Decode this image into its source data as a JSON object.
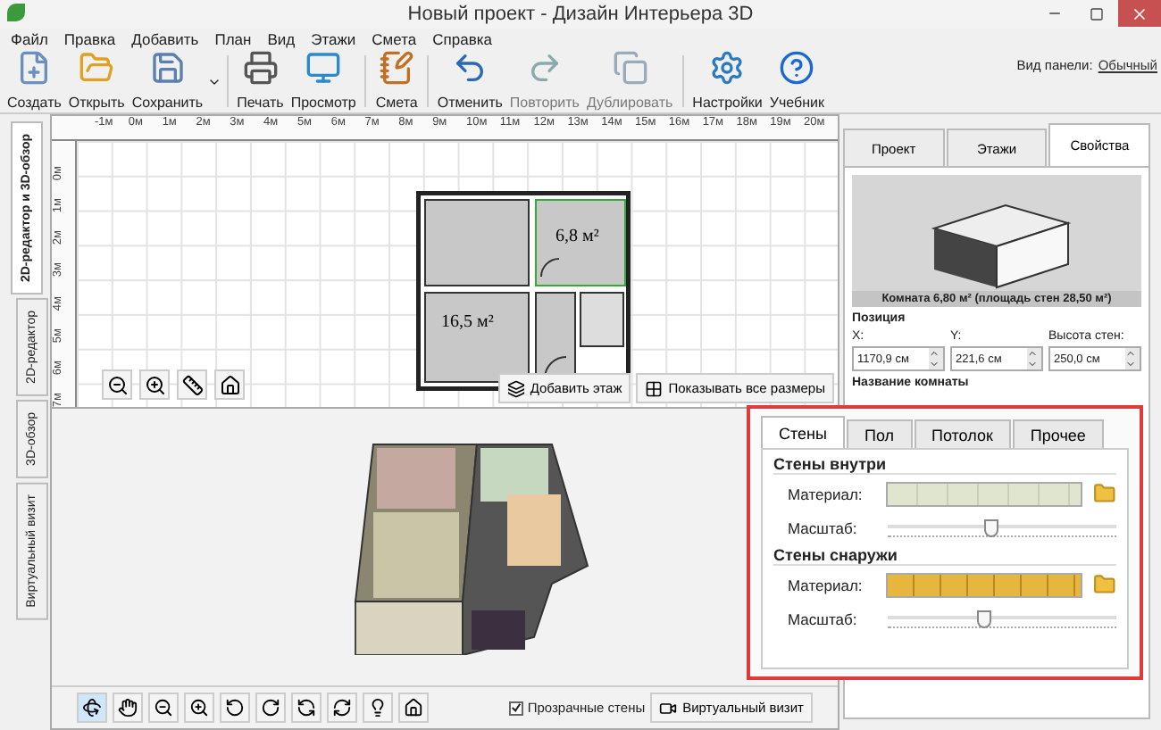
{
  "window": {
    "title": "Новый проект - Дизайн Интерьера 3D"
  },
  "menu": [
    "Файл",
    "Правка",
    "Добавить",
    "План",
    "Вид",
    "Этажи",
    "Смета",
    "Справка"
  ],
  "toolbar": {
    "buttons": [
      {
        "label": "Создать",
        "disabled": false,
        "dropdown": false
      },
      {
        "label": "Открыть",
        "disabled": false,
        "dropdown": false
      },
      {
        "label": "Сохранить",
        "disabled": false,
        "dropdown": true
      },
      {
        "label": "Печать",
        "disabled": false,
        "dropdown": false
      },
      {
        "label": "Просмотр",
        "disabled": false,
        "dropdown": false
      },
      {
        "label": "Смета",
        "disabled": false,
        "dropdown": false
      },
      {
        "label": "Отменить",
        "disabled": false,
        "dropdown": false
      },
      {
        "label": "Повторить",
        "disabled": true,
        "dropdown": false
      },
      {
        "label": "Дублировать",
        "disabled": true,
        "dropdown": false
      },
      {
        "label": "Настройки",
        "disabled": false,
        "dropdown": false
      },
      {
        "label": "Учебник",
        "disabled": false,
        "dropdown": false
      }
    ],
    "panel_view_label": "Вид панели:",
    "panel_view_value": "Обычный"
  },
  "side_tabs": [
    {
      "label": "2D-редактор и 3D-обзор",
      "selected": true
    },
    {
      "label": "2D-редактор",
      "selected": false
    },
    {
      "label": "3D-обзор",
      "selected": false
    },
    {
      "label": "Виртуальный визит",
      "selected": false
    }
  ],
  "plan": {
    "ruler_top": [
      "-1м",
      "0м",
      "1м",
      "2м",
      "3м",
      "4м",
      "5м",
      "6м",
      "7м",
      "8м",
      "9м",
      "10м",
      "11м",
      "12м",
      "13м",
      "14м",
      "15м",
      "16м",
      "17м",
      "18м",
      "19м",
      "20м"
    ],
    "ruler_left": [
      "0м",
      "1м",
      "2м",
      "3м",
      "4м",
      "5м",
      "6м",
      "7м"
    ],
    "rooms": [
      "6,8 м²",
      "16,5 м²"
    ],
    "buttons": [
      "Добавить этаж",
      "Показывать все размеры"
    ]
  },
  "view3d": {
    "transparent_walls": {
      "label": "Прозрачные стены",
      "checked": true
    },
    "virtual_visit": "Виртуальный визит"
  },
  "properties": {
    "tabs": [
      {
        "label": "Проект",
        "selected": false
      },
      {
        "label": "Этажи",
        "selected": false
      },
      {
        "label": "Свойства",
        "selected": true
      }
    ],
    "caption": "Комната 6,80 м² (площадь стен 28,50 м²)",
    "position_title": "Позиция",
    "fields": [
      {
        "label": "X:",
        "value": "1170,9 см"
      },
      {
        "label": "Y:",
        "value": "221,6 см"
      },
      {
        "label": "Высота стен:",
        "value": "250,0 см"
      }
    ],
    "room_name_title": "Название комнаты"
  },
  "materials": {
    "tabs": [
      {
        "label": "Стены",
        "selected": true
      },
      {
        "label": "Пол",
        "selected": false
      },
      {
        "label": "Потолок",
        "selected": false
      },
      {
        "label": "Прочее",
        "selected": false
      }
    ],
    "groups": [
      {
        "title": "Стены внутри",
        "material_label": "Материал:",
        "scale_label": "Масштаб:",
        "kind": "plain",
        "level": 0.45
      },
      {
        "title": "Стены снаружи",
        "material_label": "Материал:",
        "scale_label": "Масштаб:",
        "kind": "brick",
        "level": 0.42
      }
    ]
  }
}
